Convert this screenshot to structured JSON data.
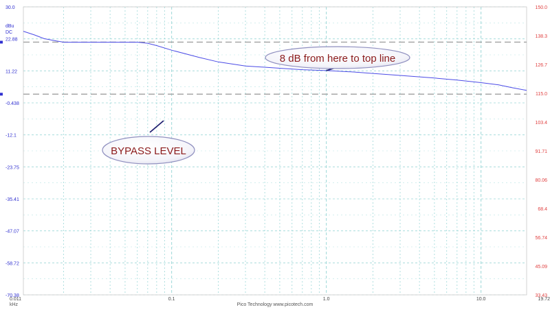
{
  "chart_data": {
    "type": "line",
    "x_scale": "log",
    "x_ticks": [
      "0.011",
      "0.1",
      "1.0",
      "10.0",
      "19.72"
    ],
    "x_range": [
      0.011,
      19.72
    ],
    "x_unit": "kHz",
    "footer": "Pico Technology  www.picotech.com",
    "left_axis": {
      "unit_line1": "dBu",
      "unit_line2": "DC",
      "ticks": [
        "30.0",
        "22.88",
        "11.22",
        "-0.438",
        "-12.1",
        "-23.75",
        "-35.41",
        "-47.07",
        "-58.72",
        "-70.38"
      ],
      "range": [
        -70.38,
        30.0
      ]
    },
    "right_axis": {
      "ticks": [
        "150.0",
        "138.3",
        "126.7",
        "115.0",
        "103.4",
        "91.71",
        "80.06",
        "68.4",
        "56.74",
        "45.09",
        "33.43"
      ],
      "range": [
        33.43,
        150.0
      ]
    },
    "grid": true,
    "colors": {
      "trace": "#4a4ae6",
      "left_axis": "#3030d0",
      "right_axis": "#e04040",
      "reference_line": "#a0a0a0",
      "grid": "#9bd7d7",
      "annotation_text": "#8b1a1a"
    },
    "series": [
      {
        "x": [
          0.011,
          0.013,
          0.015,
          0.018,
          0.02,
          0.03,
          0.04,
          0.05,
          0.06,
          0.07,
          0.08,
          0.1,
          0.15,
          0.2,
          0.3,
          0.5,
          0.7,
          1.0,
          1.5,
          2.0,
          3.0,
          5.0,
          7.0,
          10.0,
          13.0,
          16.0,
          19.72
        ],
        "y": [
          21.5,
          20.2,
          18.9,
          18.1,
          17.7,
          17.7,
          17.7,
          17.7,
          17.7,
          17.3,
          16.5,
          14.9,
          12.4,
          10.8,
          9.4,
          8.6,
          8.1,
          7.8,
          7.3,
          6.8,
          6.1,
          5.2,
          4.5,
          3.6,
          2.8,
          1.8,
          0.9
        ]
      }
    ],
    "reference_lines": [
      {
        "y": 17.7
      },
      {
        "y": -0.438
      }
    ],
    "annotations": [
      {
        "text": "8 dB from here to top line",
        "points_to": {
          "x": 1.0,
          "y": 7.8
        }
      },
      {
        "text": "BYPASS LEVEL",
        "points_to": {
          "x": 0.075,
          "y": -0.438
        }
      }
    ]
  }
}
